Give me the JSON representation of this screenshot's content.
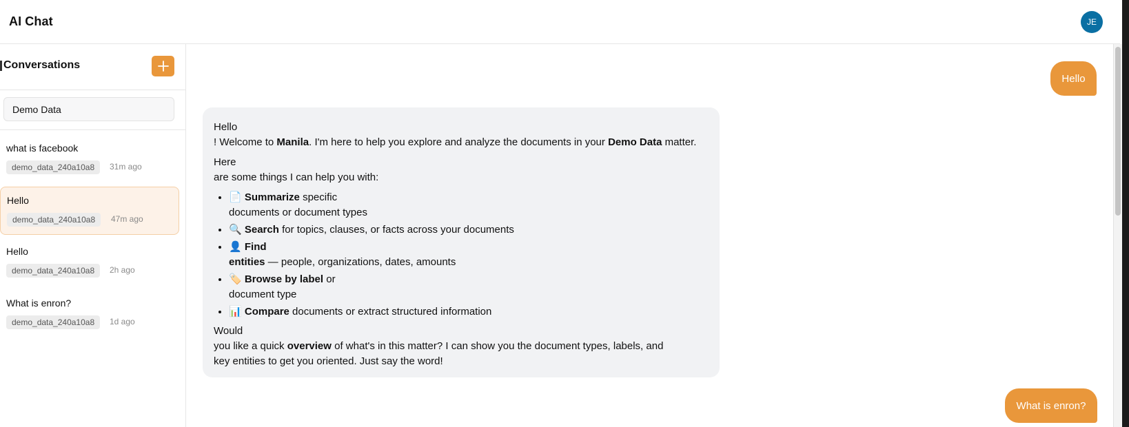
{
  "header": {
    "title": "AI Chat",
    "avatar_initials": "JE"
  },
  "sidebar": {
    "title": "Conversations",
    "new_button_icon": "plus-icon",
    "search": {
      "value": "Demo Data",
      "placeholder": ""
    },
    "conversations": [
      {
        "title": "what is facebook",
        "tag": "demo_data_240a10a8",
        "time": "31m ago",
        "active": false
      },
      {
        "title": "Hello",
        "tag": "demo_data_240a10a8",
        "time": "47m ago",
        "active": true
      },
      {
        "title": "Hello",
        "tag": "demo_data_240a10a8",
        "time": "2h ago",
        "active": false
      },
      {
        "title": "What is enron?",
        "tag": "demo_data_240a10a8",
        "time": "1d ago",
        "active": false
      }
    ]
  },
  "chat": {
    "user_message_1": "Hello",
    "assistant": {
      "line1": "Hello",
      "line2_pre": "! Welcome to ",
      "line2_bold1": "Manila",
      "line2_mid": ". I'm here to help you explore and analyze the documents in your ",
      "line2_bold2": "Demo Data",
      "line2_post": " matter.",
      "line3": "Here",
      "line4": "are some things I can help you with:",
      "items": [
        {
          "emoji": "📄",
          "bold": "Summarize",
          "text": " specific",
          "text2": "documents or document types"
        },
        {
          "emoji": "🔍",
          "bold": "Search",
          "text": " for topics, clauses, or facts across your documents"
        },
        {
          "emoji": "👤",
          "bold": "Find",
          "bold2": "entities",
          "text2": " — people, organizations, dates, amounts"
        },
        {
          "emoji": "🏷️",
          "bold": "Browse by label",
          "text": " or",
          "text2": "document type"
        },
        {
          "emoji": "📊",
          "bold": "Compare",
          "text": " documents or extract structured information"
        }
      ],
      "closing1": "Would",
      "closing2_pre": "you like a quick ",
      "closing2_bold": "overview",
      "closing2_post": " of what's in this matter? I can show you the document types, labels, and",
      "closing3": "key entities to get you oriented. Just say the word!"
    },
    "user_message_2": "What is enron?"
  },
  "colors": {
    "accent": "#e9973b",
    "avatar": "#0a6fa3",
    "active_row_bg": "#fdf2e8",
    "assistant_bubble": "#f1f2f4"
  }
}
